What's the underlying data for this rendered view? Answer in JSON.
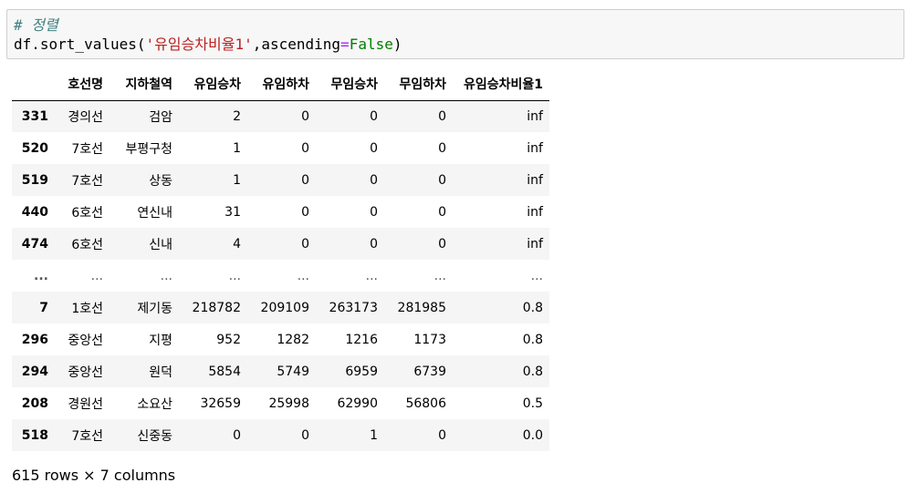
{
  "code_cell": {
    "comment": "# 정렬",
    "call_prefix": "df.sort_values(",
    "string_arg": "'유임승차비율1'",
    "separator": ",ascending",
    "equals": "=",
    "keyword": "False",
    "close_paren": ")"
  },
  "table": {
    "columns": [
      "",
      "호선명",
      "지하철역",
      "유임승차",
      "유임하차",
      "무임승차",
      "무임하차",
      "유임승차비율1"
    ],
    "rows": [
      [
        "331",
        "경의선",
        "검암",
        "2",
        "0",
        "0",
        "0",
        "inf"
      ],
      [
        "520",
        "7호선",
        "부평구청",
        "1",
        "0",
        "0",
        "0",
        "inf"
      ],
      [
        "519",
        "7호선",
        "상동",
        "1",
        "0",
        "0",
        "0",
        "inf"
      ],
      [
        "440",
        "6호선",
        "연신내",
        "31",
        "0",
        "0",
        "0",
        "inf"
      ],
      [
        "474",
        "6호선",
        "신내",
        "4",
        "0",
        "0",
        "0",
        "inf"
      ],
      [
        "...",
        "...",
        "...",
        "...",
        "...",
        "...",
        "...",
        "..."
      ],
      [
        "7",
        "1호선",
        "제기동",
        "218782",
        "209109",
        "263173",
        "281985",
        "0.8"
      ],
      [
        "296",
        "중앙선",
        "지평",
        "952",
        "1282",
        "1216",
        "1173",
        "0.8"
      ],
      [
        "294",
        "중앙선",
        "원덕",
        "5854",
        "5749",
        "6959",
        "6739",
        "0.8"
      ],
      [
        "208",
        "경원선",
        "소요산",
        "32659",
        "25998",
        "62990",
        "56806",
        "0.5"
      ],
      [
        "518",
        "7호선",
        "신중동",
        "0",
        "0",
        "1",
        "0",
        "0.0"
      ]
    ]
  },
  "footer": "615 rows × 7 columns"
}
